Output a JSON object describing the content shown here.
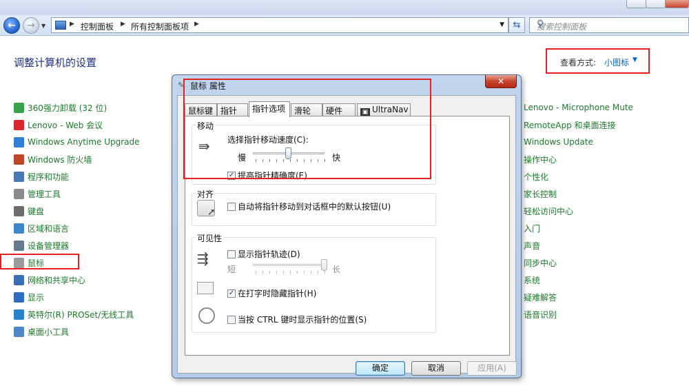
{
  "explorer": {
    "breadcrumbs": [
      "控制面板",
      "所有控制面板项"
    ],
    "search_placeholder": "搜索控制面板"
  },
  "control_panel": {
    "heading": "调整计算机的设置",
    "view_by_label": "查看方式:",
    "view_by_value": "小图标",
    "left_items": [
      {
        "label": "360强力卸载 (32 位)",
        "icon": "uninstall-icon",
        "color": "#3aa34a"
      },
      {
        "label": "Lenovo - Web 会议",
        "icon": "lenovo-web-icon",
        "color": "#d9262c"
      },
      {
        "label": "Windows Anytime Upgrade",
        "icon": "windows-flag-icon",
        "color": "#2f7fd6"
      },
      {
        "label": "Windows 防火墙",
        "icon": "firewall-icon",
        "color": "#c0462a"
      },
      {
        "label": "程序和功能",
        "icon": "programs-icon",
        "color": "#4a78b5"
      },
      {
        "label": "管理工具",
        "icon": "admin-tools-icon",
        "color": "#8a8a8a"
      },
      {
        "label": "键盘",
        "icon": "keyboard-icon",
        "color": "#6d6d6d"
      },
      {
        "label": "区域和语言",
        "icon": "globe-icon",
        "color": "#3d87c9"
      },
      {
        "label": "设备管理器",
        "icon": "device-manager-icon",
        "color": "#667a8e"
      },
      {
        "label": "鼠标",
        "icon": "mouse-icon",
        "color": "#9a9a9a"
      },
      {
        "label": "网络和共享中心",
        "icon": "network-icon",
        "color": "#3a6fb5"
      },
      {
        "label": "显示",
        "icon": "display-icon",
        "color": "#2f6bbf"
      },
      {
        "label": "英特尔(R) PROSet/无线工具",
        "icon": "wireless-icon",
        "color": "#2a83c8"
      },
      {
        "label": "桌面小工具",
        "icon": "gadgets-icon",
        "color": "#4f86c6"
      }
    ],
    "right_items": [
      "Lenovo - Microphone Mute",
      "RemoteApp 和桌面连接",
      "Windows Update",
      "操作中心",
      "个性化",
      "家长控制",
      "轻松访问中心",
      "入门",
      "声音",
      "同步中心",
      "系统",
      "疑难解答",
      "语音识别"
    ]
  },
  "dialog": {
    "title": "鼠标 属性",
    "close_label": "✕",
    "tabs": [
      "鼠标键",
      "指针",
      "指针选项",
      "滑轮",
      "硬件",
      "UltraNav"
    ],
    "active_tab": "指针选项",
    "motion": {
      "group": "移动",
      "speed_label": "选择指针移动速度(C):",
      "slow": "慢",
      "fast": "快",
      "speed_level": 0.5,
      "precision_label": "提高指针精确度(E)",
      "precision_checked": true
    },
    "snap": {
      "group": "对齐",
      "snap_label": "自动将指针移动到对话框中的默认按钮(U)",
      "snap_checked": false
    },
    "visibility": {
      "group": "可见性",
      "trails_label": "显示指针轨迹(D)",
      "trails_checked": false,
      "short": "短",
      "long": "长",
      "trails_level": 1.0,
      "hide_typing_label": "在打字时隐藏指针(H)",
      "hide_typing_checked": true,
      "ctrl_label": "当按 CTRL 键时显示指针的位置(S)",
      "ctrl_checked": false
    },
    "buttons": {
      "ok": "确定",
      "cancel": "取消",
      "apply": "应用(A)"
    }
  },
  "highlight_color": "#e52020",
  "link_color": "#1b7a2a"
}
